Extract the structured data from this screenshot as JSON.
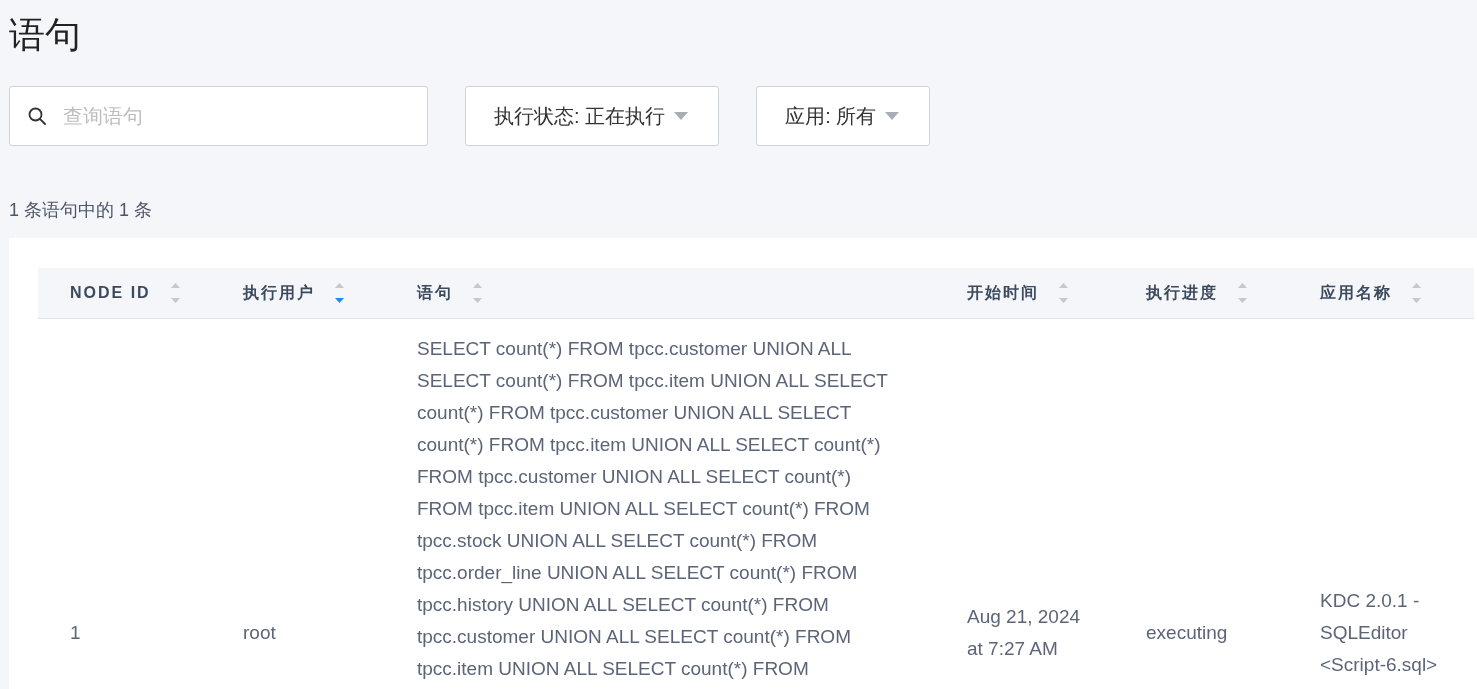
{
  "page": {
    "title": "语句"
  },
  "search": {
    "placeholder": "查询语句"
  },
  "filters": [
    {
      "label": "执行状态: 正在执行"
    },
    {
      "label": "应用: 所有"
    }
  ],
  "result_count": "1 条语句中的 1 条",
  "table": {
    "columns": [
      {
        "label": "NODE ID",
        "sorted_descending": false
      },
      {
        "label": "执行用户",
        "sorted_descending": true
      },
      {
        "label": "语句",
        "sorted_descending": false
      },
      {
        "label": "开始时间",
        "sorted_descending": false
      },
      {
        "label": "执行进度",
        "sorted_descending": false
      },
      {
        "label": "应用名称",
        "sorted_descending": false
      }
    ],
    "rows": [
      {
        "cells": [
          "1",
          "root",
          "SELECT count(*) FROM tpcc.customer UNION ALL SELECT count(*) FROM tpcc.item UNION ALL SELECT count(*) FROM tpcc.customer UNION ALL SELECT count(*) FROM tpcc.item UNION ALL SELECT count(*) FROM tpcc.customer UNION ALL SELECT count(*) FROM tpcc.item UNION ALL SELECT count(*) FROM tpcc.stock UNION ALL SELECT count(*) FROM tpcc.order_line UNION ALL SELECT count(*) FROM tpcc.history UNION ALL SELECT count(*) FROM tpcc.customer UNION ALL SELECT count(*) FROM tpcc.item UNION ALL SELECT count(*) FROM",
          "Aug 21, 2024 at 7:27 AM",
          "executing",
          "KDC 2.0.1 - SQLEditor <Script-6.sql>"
        ]
      }
    ]
  }
}
